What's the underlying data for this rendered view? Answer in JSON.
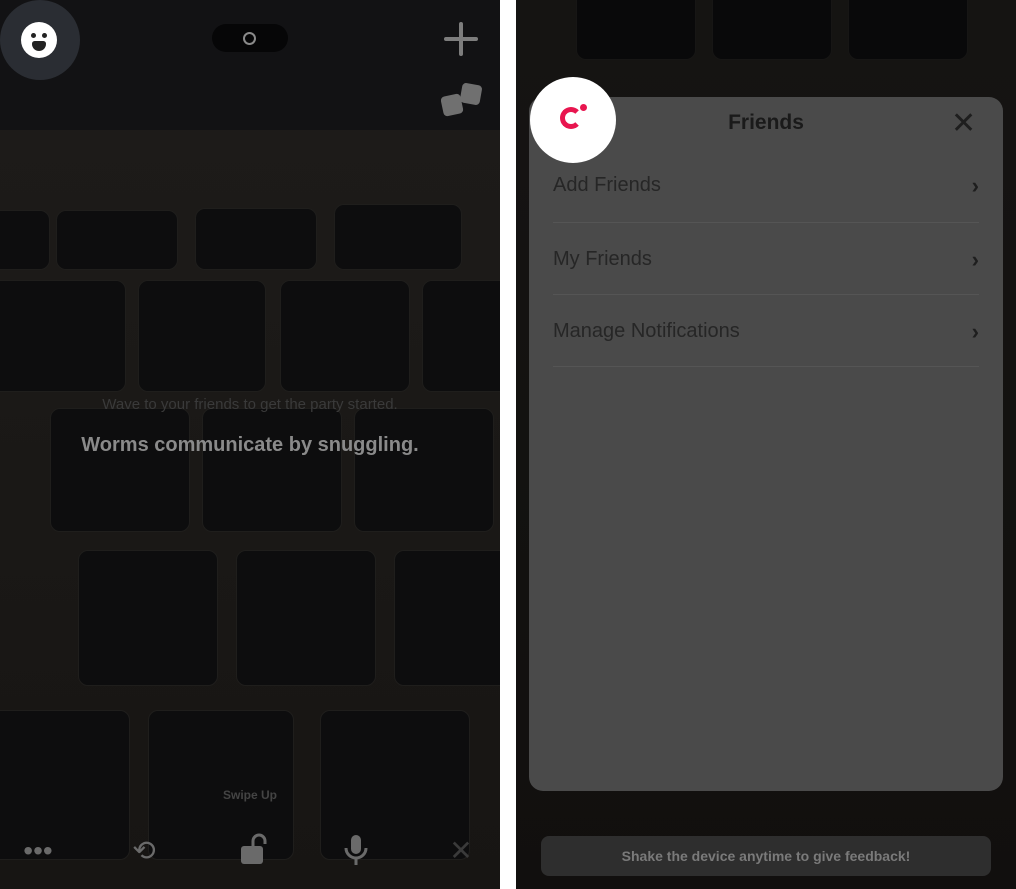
{
  "left_screen": {
    "hint": "Wave to your friends to get the party started.",
    "fact": "Worms communicate by snuggling.",
    "swipe_label": "Swipe Up",
    "icons": [
      "emoji-face-icon",
      "camera-toggle-icon",
      "plus-icon",
      "dice-icon",
      "more-icon",
      "flip-camera-icon",
      "unlock-icon",
      "microphone-icon",
      "close-icon"
    ]
  },
  "right_screen": {
    "modal": {
      "title": "Friends",
      "items": [
        {
          "label": "Add Friends"
        },
        {
          "label": "My Friends"
        },
        {
          "label": "Manage Notifications"
        }
      ]
    },
    "feedback": "Shake the device anytime to give feedback!",
    "accent_color": "#e8154f"
  }
}
